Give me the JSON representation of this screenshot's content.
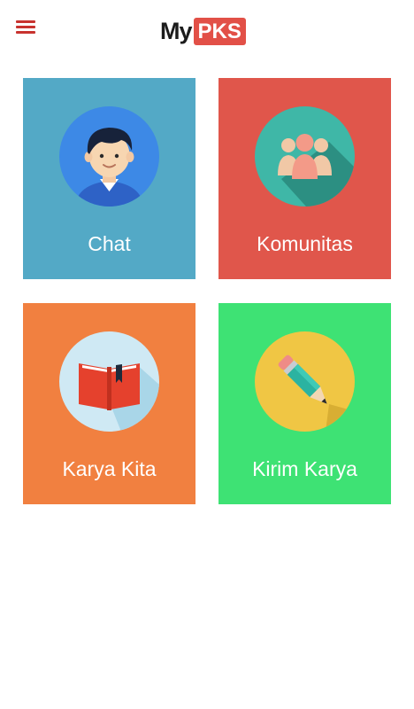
{
  "header": {
    "menu_icon": "hamburger-menu-icon",
    "logo_my": "My",
    "logo_pks": "PKS"
  },
  "tiles": [
    {
      "label": "Chat",
      "icon": "user-avatar-icon",
      "color": "#53a9c6"
    },
    {
      "label": "Komunitas",
      "icon": "community-group-icon",
      "color": "#e0564b"
    },
    {
      "label": "Karya Kita",
      "icon": "book-icon",
      "color": "#f18040"
    },
    {
      "label": "Kirim Karya",
      "icon": "pencil-icon",
      "color": "#3ee274"
    }
  ],
  "colors": {
    "accent": "#e25047",
    "menu": "#c8332f"
  }
}
